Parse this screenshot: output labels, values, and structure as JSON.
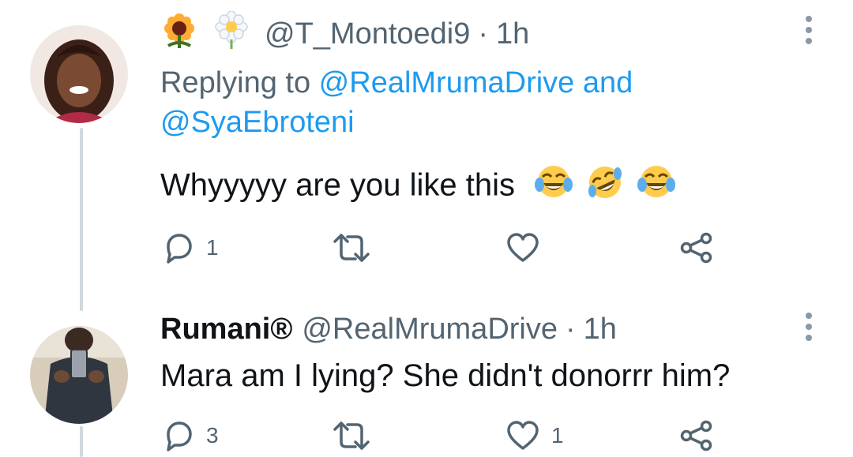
{
  "tweet1": {
    "badges": [
      "sunflower-icon",
      "blossom-icon"
    ],
    "handle": "@T_Montoedi9",
    "separator": "·",
    "time": "1h",
    "replying_prefix": "Replying to ",
    "reply_user1": "@RealMrumaDrive",
    "reply_and": " and",
    "reply_user2": "@SyaEbroteni",
    "text": "Whyyyyy are you like this",
    "emojis": [
      "tears-of-joy-icon",
      "rofl-icon",
      "tears-of-joy-icon"
    ],
    "reply_count": "1",
    "retweet_count": "",
    "like_count": ""
  },
  "tweet2": {
    "name": "Rumani®",
    "handle": "@RealMrumaDrive",
    "separator": "·",
    "time": "1h",
    "text": "Mara am I lying? She didn't donorrr him?",
    "reply_count": "3",
    "retweet_count": "",
    "like_count": "1"
  },
  "colors": {
    "accent": "#1d9bf0",
    "muted": "#536471",
    "thread_line": "#cfd9de",
    "text": "#0f1419"
  }
}
